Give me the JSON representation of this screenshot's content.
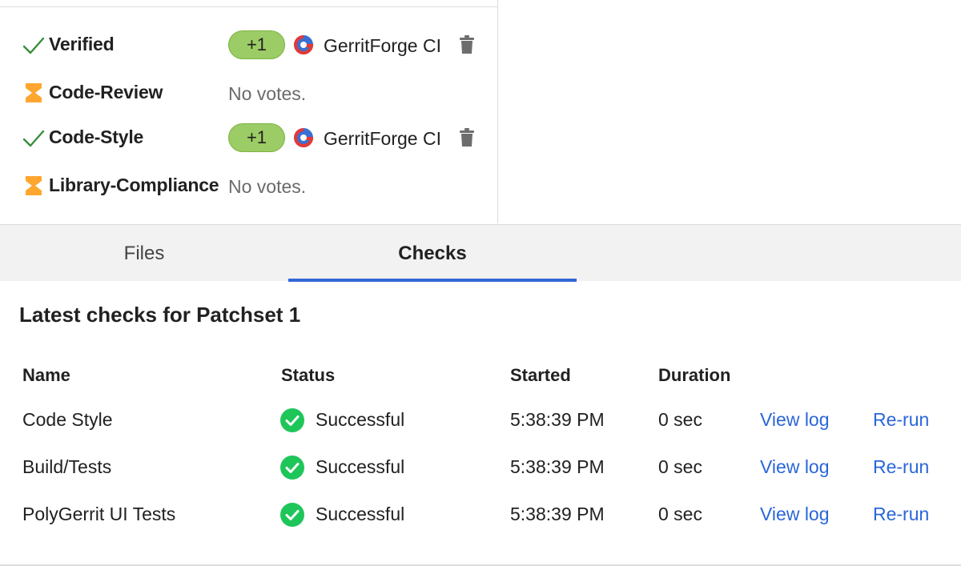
{
  "labels": [
    {
      "name": "Verified",
      "status": "approved",
      "vote": "+1",
      "account": "GerritForge CI",
      "no_votes": ""
    },
    {
      "name": "Code-Review",
      "status": "pending",
      "vote": "",
      "account": "",
      "no_votes": "No votes."
    },
    {
      "name": "Code-Style",
      "status": "approved",
      "vote": "+1",
      "account": "GerritForge CI",
      "no_votes": ""
    },
    {
      "name": "Library-Compliance",
      "status": "pending",
      "vote": "",
      "account": "",
      "no_votes": "No votes."
    }
  ],
  "tabs": [
    {
      "label": "Files",
      "selected": false
    },
    {
      "label": "Checks",
      "selected": true
    }
  ],
  "checks": {
    "heading": "Latest checks for Patchset 1",
    "columns": {
      "name": "Name",
      "status": "Status",
      "started": "Started",
      "duration": "Duration"
    },
    "rows": [
      {
        "name": "Code Style",
        "status": "Successful",
        "started": "5:38:39 PM",
        "duration": "0 sec",
        "view_log": "View log",
        "rerun": "Re-run"
      },
      {
        "name": "Build/Tests",
        "status": "Successful",
        "started": "5:38:39 PM",
        "duration": "0 sec",
        "view_log": "View log",
        "rerun": "Re-run"
      },
      {
        "name": "PolyGerrit UI Tests",
        "status": "Successful",
        "started": "5:38:39 PM",
        "duration": "0 sec",
        "view_log": "View log",
        "rerun": "Re-run"
      }
    ]
  },
  "icons": {
    "approved": "check-icon",
    "pending": "hourglass-icon",
    "avatar": "gerritforge-logo-icon",
    "delete": "trash-icon",
    "status_success": "check-circle-icon"
  },
  "colors": {
    "vote_chip": "#9ccc65",
    "approved_check": "#388e3c",
    "pending_hourglass": "#ffa62f",
    "success_circle": "#1ec65a",
    "link": "#2a66d9",
    "tab_underline": "#3367d6"
  }
}
